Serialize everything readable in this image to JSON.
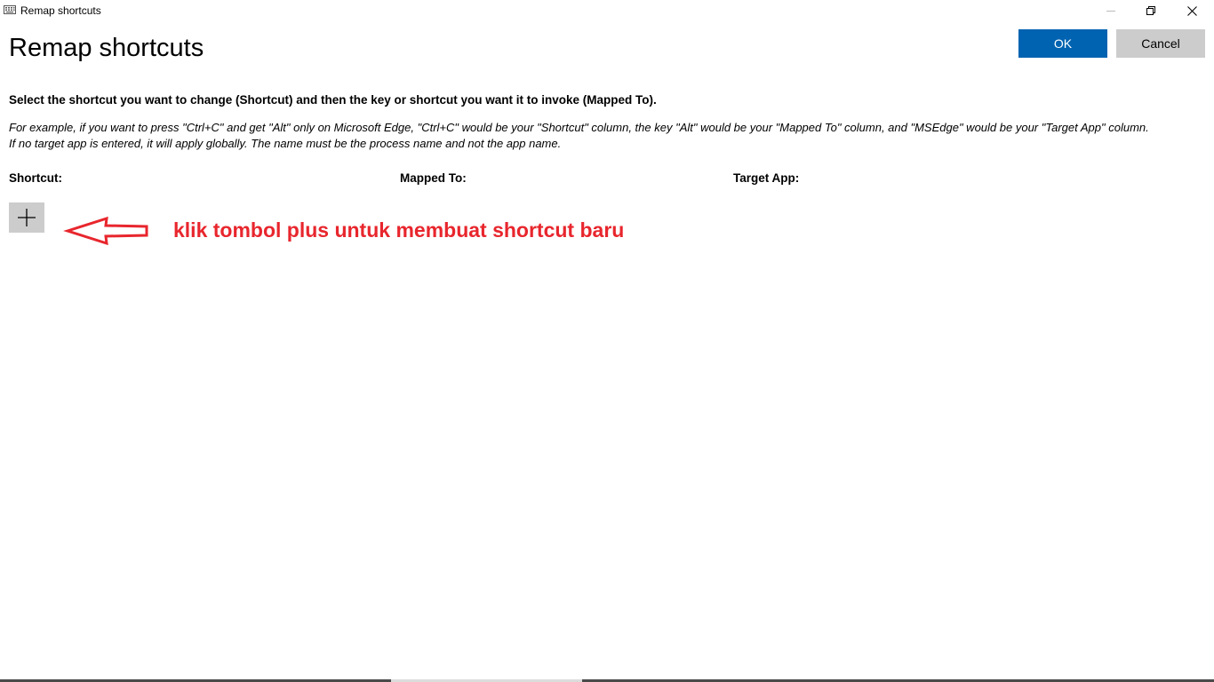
{
  "window": {
    "title": "Remap shortcuts",
    "app_icon": "keyboard-icon",
    "controls": {
      "minimize_icon": "minimize-icon",
      "maximize_icon": "restore-icon",
      "close_icon": "close-icon"
    }
  },
  "header": {
    "title": "Remap shortcuts",
    "ok_label": "OK",
    "cancel_label": "Cancel"
  },
  "instruction": "Select the shortcut you want to change (Shortcut) and then the key or shortcut you want it to invoke (Mapped To).",
  "example": {
    "line1": "For example, if you want to press \"Ctrl+C\" and get \"Alt\" only on Microsoft Edge, \"Ctrl+C\" would be your \"Shortcut\" column, the key \"Alt\" would be your \"Mapped To\" column, and \"MSEdge\" would be your \"Target App\" column.",
    "line2": "If no target app is entered, it will apply globally. The name must be the process name and not the app name."
  },
  "columns": {
    "shortcut": "Shortcut:",
    "mapped_to": "Mapped To:",
    "target_app": "Target App:"
  },
  "add_button": {
    "icon": "plus-icon"
  },
  "annotation": {
    "text": "klik tombol plus untuk membuat shortcut baru",
    "color": "#e8262d",
    "arrow_icon": "left-arrow-icon"
  },
  "colors": {
    "accent": "#0063b1",
    "secondary_button": "#cccccc",
    "annotation": "#e8262d"
  }
}
